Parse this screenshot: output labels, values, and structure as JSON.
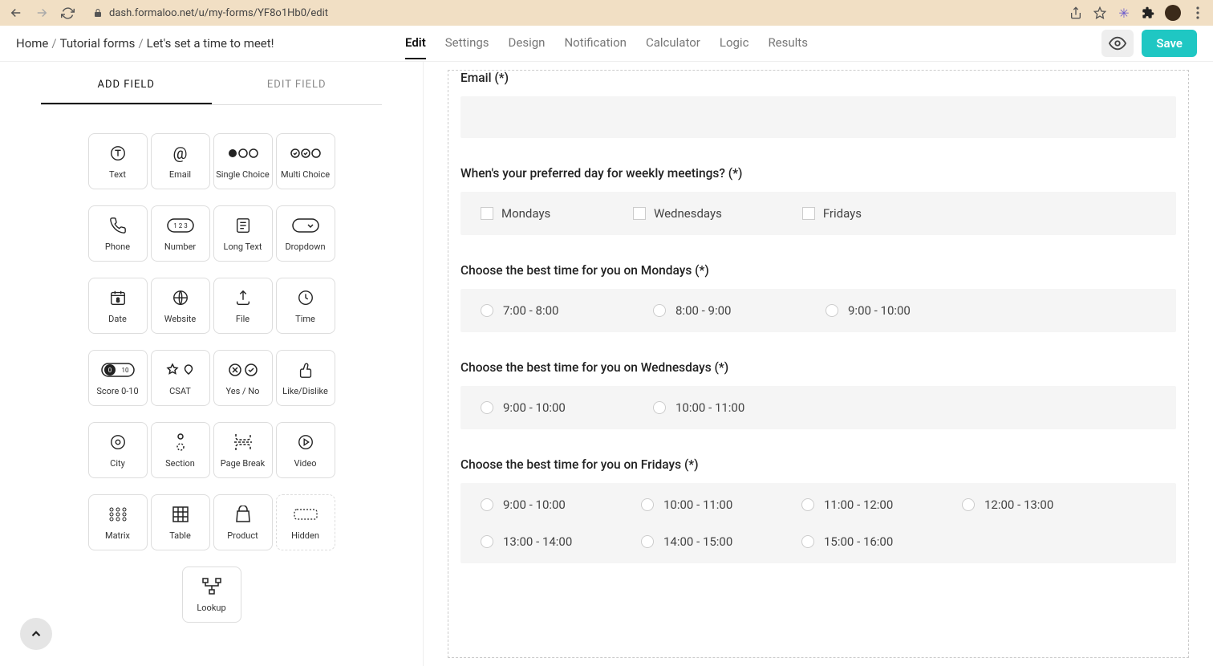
{
  "url": "dash.formaloo.net/u/my-forms/YF8o1Hb0/edit",
  "breadcrumb": {
    "home": "Home",
    "forms": "Tutorial forms",
    "current": "Let's set a time to meet!"
  },
  "tabs": {
    "edit": "Edit",
    "settings": "Settings",
    "design": "Design",
    "notification": "Notification",
    "calculator": "Calculator",
    "logic": "Logic",
    "results": "Results"
  },
  "top": {
    "save": "Save"
  },
  "sidebar": {
    "add_tab": "ADD FIELD",
    "edit_tab": "EDIT FIELD",
    "fields": {
      "text": "Text",
      "email": "Email",
      "single": "Single Choice",
      "multi": "Multi Choice",
      "phone": "Phone",
      "number": "Number",
      "longtext": "Long Text",
      "dropdown": "Dropdown",
      "date": "Date",
      "website": "Website",
      "file": "File",
      "time": "Time",
      "score": "Score 0-10",
      "csat": "CSAT",
      "yesno": "Yes / No",
      "like": "Like/Dislike",
      "city": "City",
      "section": "Section",
      "pagebreak": "Page Break",
      "video": "Video",
      "matrix": "Matrix",
      "table": "Table",
      "product": "Product",
      "hidden": "Hidden",
      "lookup": "Lookup"
    }
  },
  "form": {
    "q_email": "Email (*)",
    "q_day": "When's your preferred day for weekly meetings? (*)",
    "day_opts": {
      "mon": "Mondays",
      "wed": "Wednesdays",
      "fri": "Fridays"
    },
    "q_mon": "Choose the best time for you on Mondays (*)",
    "mon_opts": {
      "a": "7:00 - 8:00",
      "b": "8:00 - 9:00",
      "c": "9:00 - 10:00"
    },
    "q_wed": "Choose the best time for you on Wednesdays (*)",
    "wed_opts": {
      "a": "9:00 - 10:00",
      "b": "10:00 - 11:00"
    },
    "q_fri": "Choose the best time for you on Fridays (*)",
    "fri_opts": {
      "a": "9:00 - 10:00",
      "b": "10:00 - 11:00",
      "c": "11:00 - 12:00",
      "d": "12:00 - 13:00",
      "e": "13:00 - 14:00",
      "f": "14:00 - 15:00",
      "g": "15:00 - 16:00"
    }
  }
}
